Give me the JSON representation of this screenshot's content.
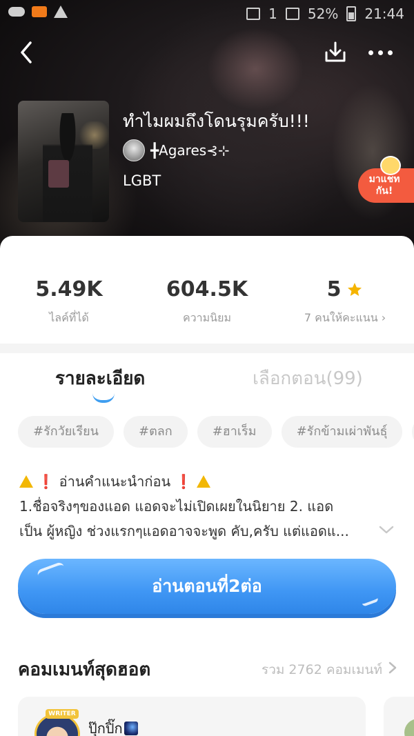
{
  "statusbar": {
    "battery": "52%",
    "time": "21:44",
    "sim": "1"
  },
  "header": {
    "story_title": "ทำไมผมถึงโดนรุมครับ!!!",
    "author": "╋Agares⊰⊹",
    "genre": "LGBT",
    "chat_badge": "มาแชท\nกัน!"
  },
  "stats": [
    {
      "value": "5.49K",
      "label": "ไลค์ที่ได้"
    },
    {
      "value": "604.5K",
      "label": "ความนิยม"
    },
    {
      "value": "5",
      "label": "7 คนให้คะแนน ›"
    }
  ],
  "tabs": {
    "active": "รายละเอียด",
    "inactive": "เลือกตอน(99)"
  },
  "tags": [
    "#รักวัยเรียน",
    "#ตลก",
    "#ฮาเร็ม",
    "#รักข้ามเผ่าพันธุ์",
    "#"
  ],
  "description": {
    "line1": "❗ อ่านคำแนะนำก่อน ❗",
    "line2": "1.ชื่อจริงๆของแอด แอดจะไม่เปิดเผยในนิยาย 2. แอด",
    "line3": "เป็น ผู้หญิง ช่วงแรกๆแอดอาจจะพูด คับ,ครับ แต่แอดแ..."
  },
  "read_button": "อ่านตอนที่2ต่อ",
  "comments": {
    "title": "คอมเมนท์สุดฮอต",
    "total": "รวม 2762 คอมเมนท์",
    "first": {
      "badge": "WRITER",
      "name": "ปุ๊กปิ๊ก"
    }
  },
  "colors": {
    "accent": "#3f96f4",
    "badge": "#f35b3f",
    "star": "#f5b400",
    "warn": "#f2b705"
  }
}
